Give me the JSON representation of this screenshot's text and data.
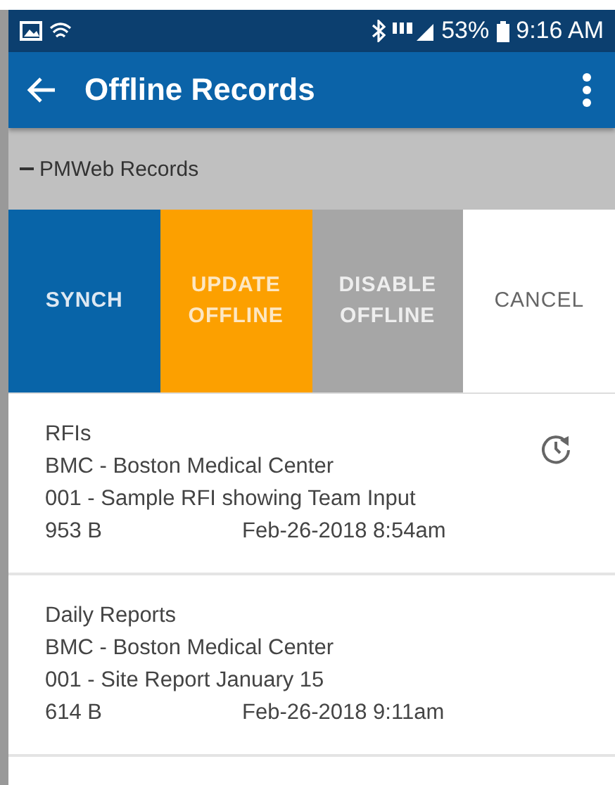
{
  "status_bar": {
    "battery": "53%",
    "time": "9:16 AM"
  },
  "app_bar": {
    "title": "Offline Records"
  },
  "section": {
    "label": "PMWeb Records",
    "expanded": true
  },
  "actions": [
    {
      "label": "SYNCH",
      "kind": "primary"
    },
    {
      "label": "UPDATE OFFLINE",
      "kind": "warning"
    },
    {
      "label": "DISABLE OFFLINE",
      "kind": "muted"
    },
    {
      "label": "CANCEL",
      "kind": "plain"
    }
  ],
  "records": [
    {
      "module": "RFIs",
      "project": "BMC - Boston Medical Center",
      "title": "001 - Sample RFI showing Team Input",
      "size": "953 B",
      "date": "Feb-26-2018 8:54am",
      "update_pending": true
    },
    {
      "module": "Daily Reports",
      "project": "BMC - Boston Medical Center",
      "title": "001 - Site Report January 15",
      "size": "614 B",
      "date": "Feb-26-2018 9:11am",
      "update_pending": false
    }
  ]
}
